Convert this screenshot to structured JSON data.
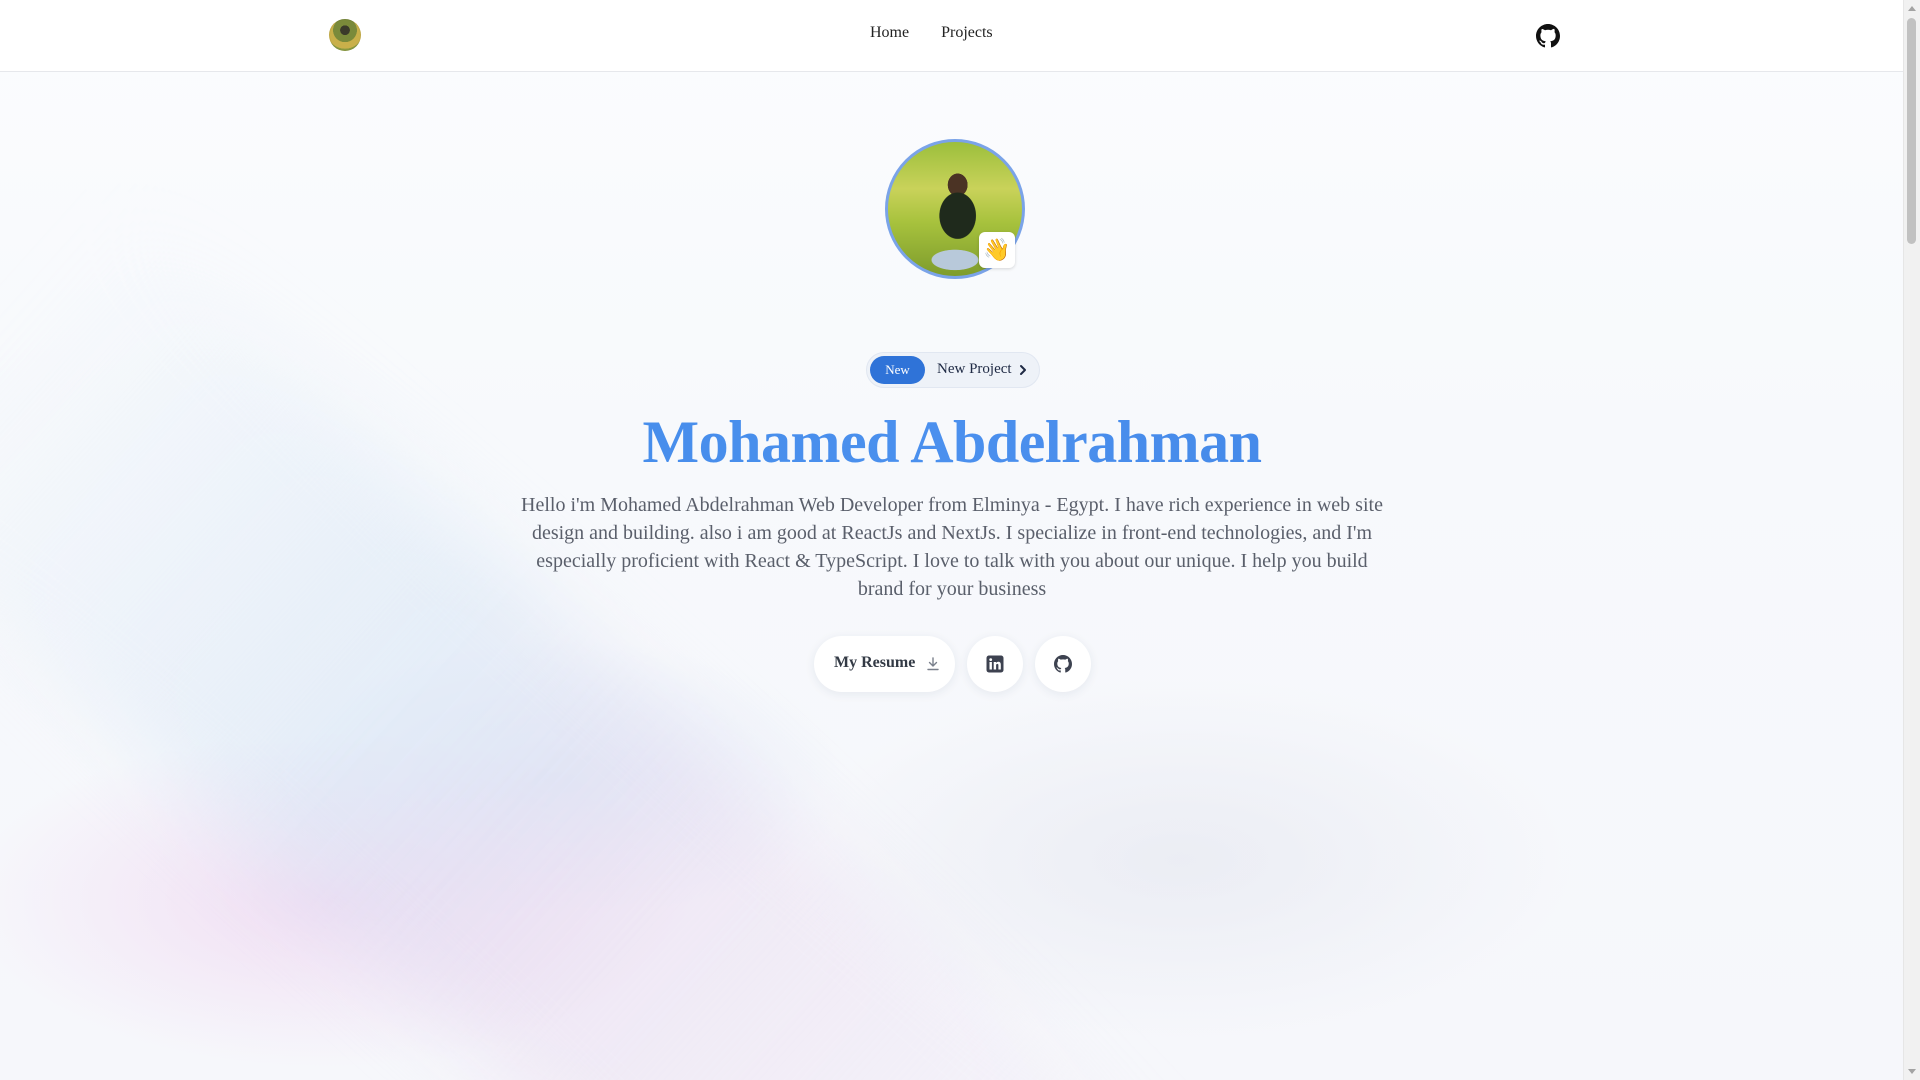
{
  "header": {
    "nav": [
      {
        "label": "Home"
      },
      {
        "label": "Projects"
      }
    ]
  },
  "hero": {
    "wave_emoji": "👋",
    "badge_label": "New",
    "announcement": "New Project",
    "name": "Mohamed Abdelrahman",
    "bio": "Hello i'm Mohamed Abdelrahman Web Developer from Elminya - Egypt. I have rich experience in web site design and building. also i am good at ReactJs and NextJs. I specialize in front-end technologies, and I'm especially proficient with React & TypeScript. I love to talk with you about our unique. I help you build brand for your business",
    "resume_label": "My Resume"
  },
  "icons": {
    "header_logo": "avatar-logo",
    "header_github": "github-icon",
    "chevron": "chevron-right-icon",
    "download": "download-icon",
    "linkedin": "linkedin-icon",
    "github": "github-icon"
  },
  "colors": {
    "accent": "#2f73d8",
    "name_gradient": "#3b82e6",
    "avatar_border": "#7aa3e8",
    "text_muted": "#5a5f6b"
  }
}
